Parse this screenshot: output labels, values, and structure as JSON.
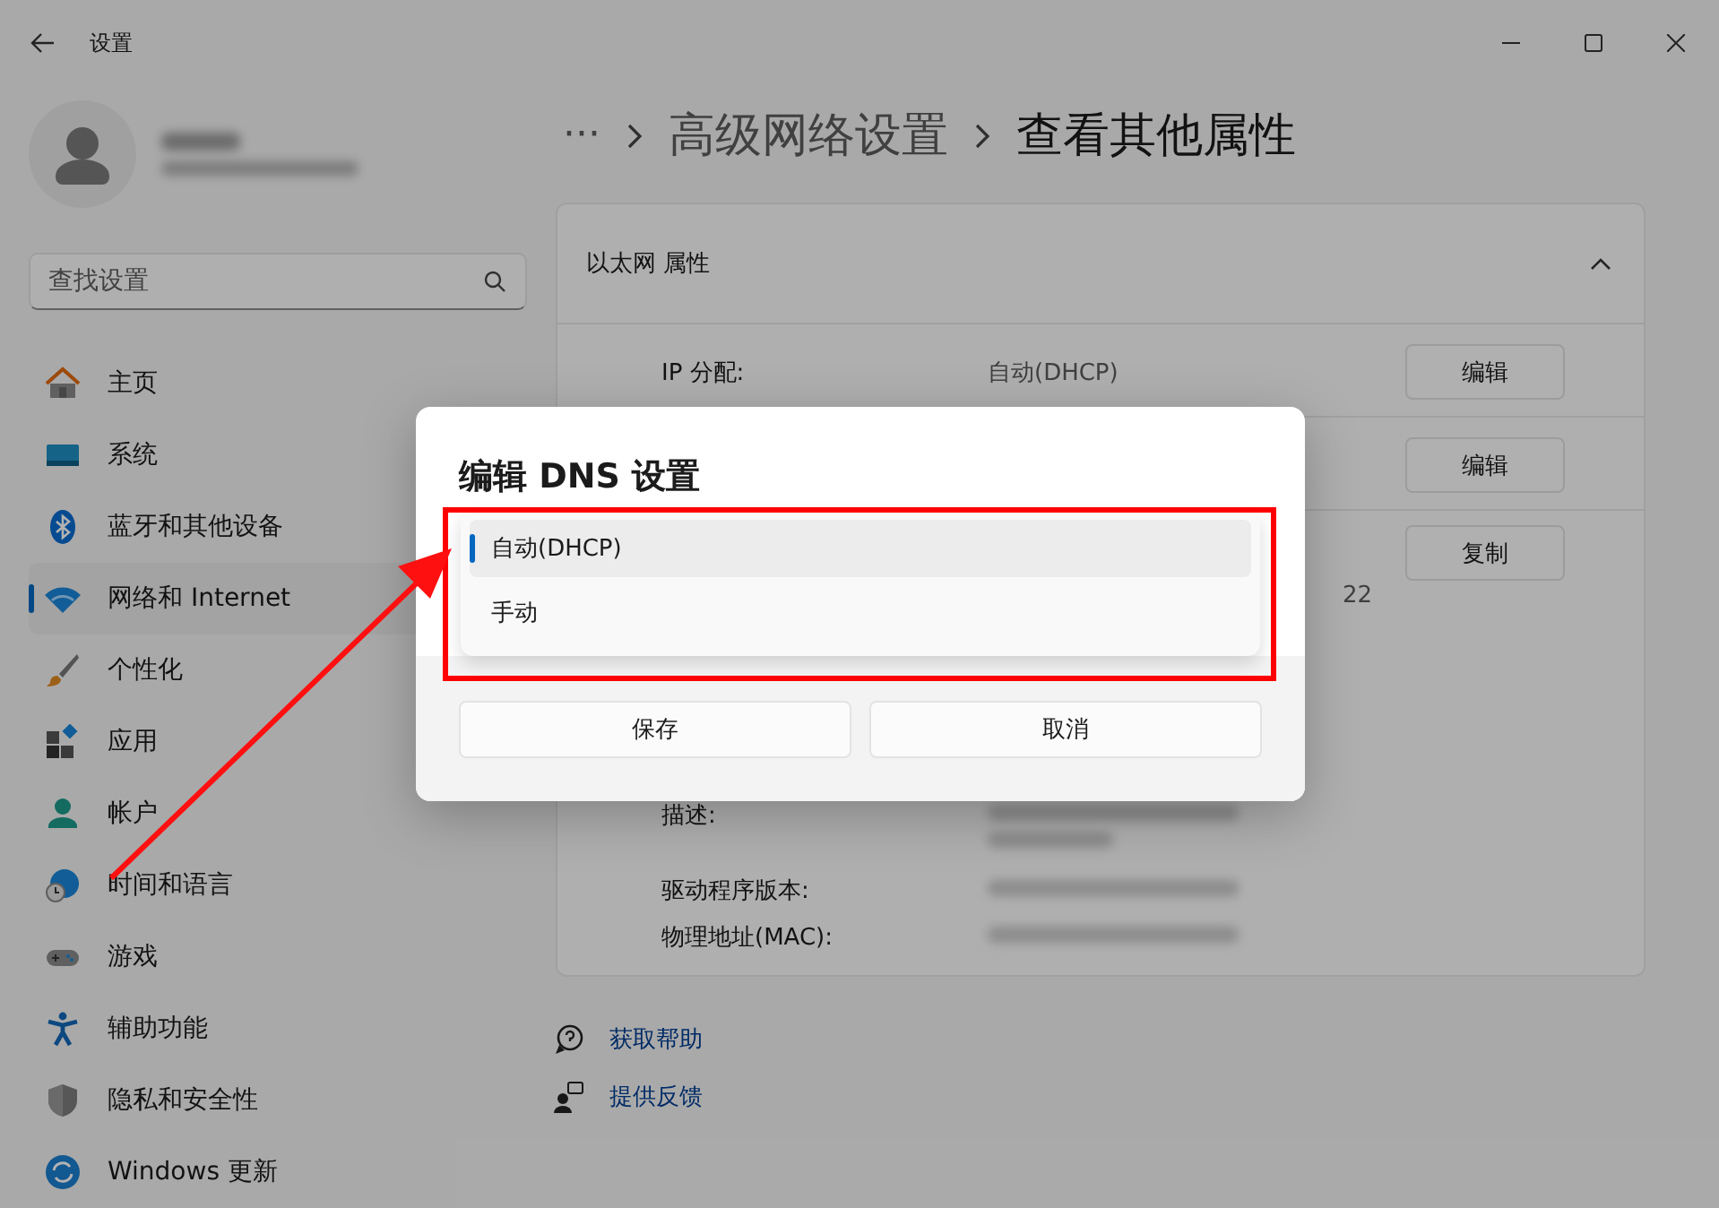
{
  "window": {
    "title": "设置"
  },
  "search": {
    "placeholder": "查找设置"
  },
  "nav": [
    {
      "label": "主页",
      "kind": "home",
      "selected": false
    },
    {
      "label": "系统",
      "kind": "system",
      "selected": false
    },
    {
      "label": "蓝牙和其他设备",
      "kind": "bluetooth",
      "selected": false
    },
    {
      "label": "网络和 Internet",
      "kind": "network",
      "selected": true
    },
    {
      "label": "个性化",
      "kind": "brush",
      "selected": false
    },
    {
      "label": "应用",
      "kind": "apps",
      "selected": false
    },
    {
      "label": "帐户",
      "kind": "account",
      "selected": false
    },
    {
      "label": "时间和语言",
      "kind": "time",
      "selected": false
    },
    {
      "label": "游戏",
      "kind": "games",
      "selected": false
    },
    {
      "label": "辅助功能",
      "kind": "accessibility",
      "selected": false
    },
    {
      "label": "隐私和安全性",
      "kind": "shield",
      "selected": false
    },
    {
      "label": "Windows 更新",
      "kind": "update",
      "selected": false
    }
  ],
  "breadcrumb": {
    "overflow": "···",
    "items": [
      "高级网络设置",
      "查看其他属性"
    ]
  },
  "card": {
    "title": "以太网 属性",
    "expanded": true,
    "rows": [
      {
        "label": "IP 分配:",
        "value": "自动(DHCP)",
        "button": "编辑"
      },
      {
        "button": "编辑"
      },
      {
        "value": "22",
        "button": "复制"
      }
    ],
    "details": [
      {
        "label": "描述:"
      },
      {
        "label": "驱动程序版本:"
      },
      {
        "label": "物理地址(MAC):"
      }
    ]
  },
  "links": [
    {
      "text": "获取帮助",
      "kind": "help"
    },
    {
      "text": "提供反馈",
      "kind": "feedback"
    }
  ],
  "dialog": {
    "title": "编辑 DNS 设置",
    "options": [
      {
        "label": "自动(DHCP)",
        "selected": true
      },
      {
        "label": "手动",
        "selected": false
      }
    ],
    "buttons": [
      "保存",
      "取消"
    ]
  }
}
